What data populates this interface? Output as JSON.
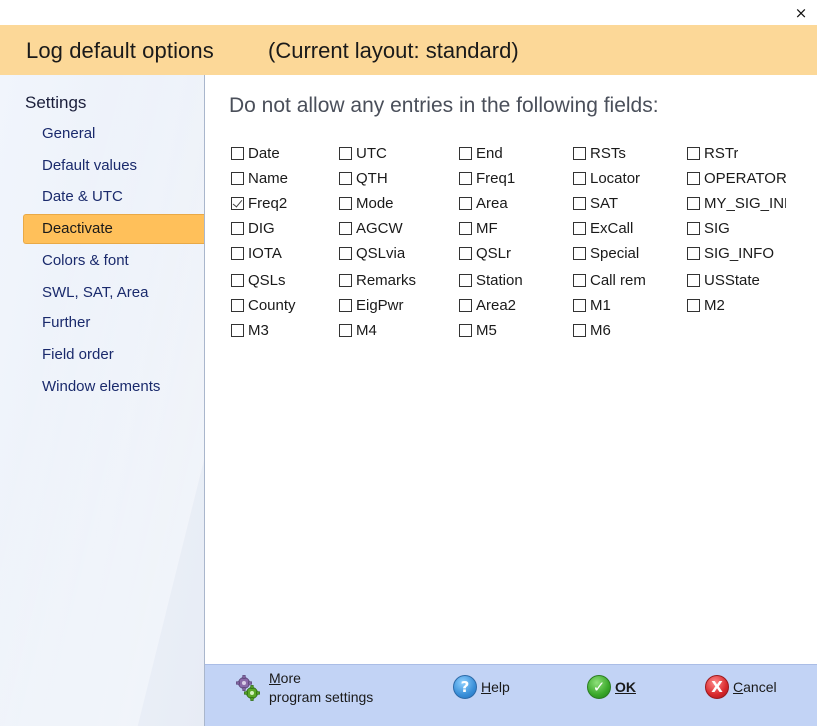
{
  "window": {
    "close_icon": "×"
  },
  "header": {
    "title": "Log default options",
    "layout": "(Current layout: standard)"
  },
  "sidebar": {
    "heading": "Settings",
    "items": [
      {
        "label": "General",
        "selected": false
      },
      {
        "label": "Default values",
        "selected": false
      },
      {
        "label": "Date & UTC",
        "selected": false
      },
      {
        "label": "Deactivate",
        "selected": true
      },
      {
        "label": "Colors & font",
        "selected": false
      },
      {
        "label": "SWL, SAT, Area",
        "selected": false
      },
      {
        "label": "Further",
        "selected": false
      },
      {
        "label": "Field order",
        "selected": false
      },
      {
        "label": "Window elements",
        "selected": false
      }
    ]
  },
  "main": {
    "heading": "Do not allow any entries in the following fields:",
    "fields": [
      {
        "label": "Date",
        "checked": false
      },
      {
        "label": "UTC",
        "checked": false
      },
      {
        "label": "End",
        "checked": false
      },
      {
        "label": "RSTs",
        "checked": false
      },
      {
        "label": "RSTr",
        "checked": false
      },
      {
        "label": "Name",
        "checked": false
      },
      {
        "label": "QTH",
        "checked": false
      },
      {
        "label": "Freq1",
        "checked": false
      },
      {
        "label": "Locator",
        "checked": false
      },
      {
        "label": "OPERATOR",
        "checked": false
      },
      {
        "label": "Freq2",
        "checked": true
      },
      {
        "label": "Mode",
        "checked": false
      },
      {
        "label": "Area",
        "checked": false
      },
      {
        "label": "SAT",
        "checked": false
      },
      {
        "label": "MY_SIG_INFO",
        "checked": false
      },
      {
        "label": "DIG",
        "checked": false
      },
      {
        "label": "AGCW",
        "checked": false
      },
      {
        "label": "MF",
        "checked": false
      },
      {
        "label": "ExCall",
        "checked": false
      },
      {
        "label": "SIG",
        "checked": false
      },
      {
        "label": "IOTA",
        "checked": false
      },
      {
        "label": "QSLvia",
        "checked": false
      },
      {
        "label": "QSLr",
        "checked": false
      },
      {
        "label": "Special",
        "checked": false
      },
      {
        "label": "SIG_INFO",
        "checked": false
      },
      {
        "label": "QSLs",
        "checked": false
      },
      {
        "label": "Remarks",
        "checked": false
      },
      {
        "label": "Station",
        "checked": false
      },
      {
        "label": "Call rem",
        "checked": false
      },
      {
        "label": "USState",
        "checked": false
      },
      {
        "label": "County",
        "checked": false
      },
      {
        "label": "EigPwr",
        "checked": false
      },
      {
        "label": "Area2",
        "checked": false
      },
      {
        "label": "M1",
        "checked": false
      },
      {
        "label": "M2",
        "checked": false
      },
      {
        "label": "M3",
        "checked": false
      },
      {
        "label": "M4",
        "checked": false
      },
      {
        "label": "M5",
        "checked": false
      },
      {
        "label": "M6",
        "checked": false
      }
    ]
  },
  "footer": {
    "more_line1_accel": "M",
    "more_line1_rest": "ore",
    "more_line2": "program settings",
    "help_accel": "H",
    "help_rest": "elp",
    "ok_label": "OK",
    "cancel_accel": "C",
    "cancel_rest": "ancel",
    "help_icon": "?",
    "ok_icon": "✓",
    "cancel_icon": "X"
  }
}
